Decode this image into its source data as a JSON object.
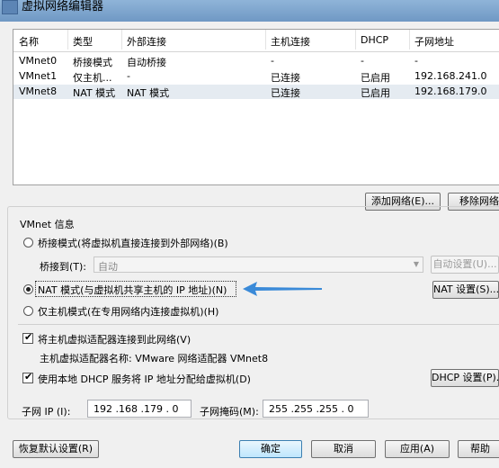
{
  "window": {
    "title": "虚拟网络编辑器"
  },
  "table": {
    "headers": [
      "名称",
      "类型",
      "外部连接",
      "主机连接",
      "DHCP",
      "子网地址"
    ],
    "rows": [
      [
        "VMnet0",
        "桥接模式",
        "自动桥接",
        "-",
        "-",
        "-"
      ],
      [
        "VMnet1",
        "仅主机...",
        "-",
        "已连接",
        "已启用",
        "192.168.241.0"
      ],
      [
        "VMnet8",
        "NAT 模式",
        "NAT 模式",
        "已连接",
        "已启用",
        "192.168.179.0"
      ]
    ]
  },
  "table_buttons": {
    "add_network": "添加网络(E)...",
    "remove_network": "移除网络"
  },
  "vmnet_info": {
    "group_label": "VMnet 信息",
    "bridged_label": "桥接模式(将虚拟机直接连接到外部网络)(B)",
    "bridge_to_label": "桥接到(T):",
    "bridge_to_value": "自动",
    "auto_settings_button": "自动设置(U)...",
    "nat_label": "NAT 模式(与虚拟机共享主机的 IP 地址)(N)",
    "nat_settings_button": "NAT 设置(S)...",
    "hostonly_label": "仅主机模式(在专用网络内连接虚拟机)(H)",
    "selected_mode": "nat",
    "connect_adapter_label": "将主机虚拟适配器连接到此网络(V)",
    "connect_adapter_checked": true,
    "adapter_name_label": "主机虚拟适配器名称: VMware 网络适配器 VMnet8",
    "dhcp_label": "使用本地 DHCP 服务将 IP 地址分配给虚拟机(D)",
    "dhcp_checked": true,
    "dhcp_settings_button": "DHCP 设置(P)...",
    "subnet_ip_label": "子网 IP (I):",
    "subnet_ip_value": "192 .168 .179 .  0",
    "subnet_mask_label": "子网掩码(M):",
    "subnet_mask_value": "255 .255 .255 .  0"
  },
  "footer": {
    "restore_defaults": "恢复默认设置(R)",
    "ok": "确定",
    "cancel": "取消",
    "apply": "应用(A)",
    "help": "帮助"
  },
  "colors": {
    "selected_row": "#e5ebf1",
    "arrow": "#3a8ad8",
    "titlebar": "#7fa6cf"
  }
}
